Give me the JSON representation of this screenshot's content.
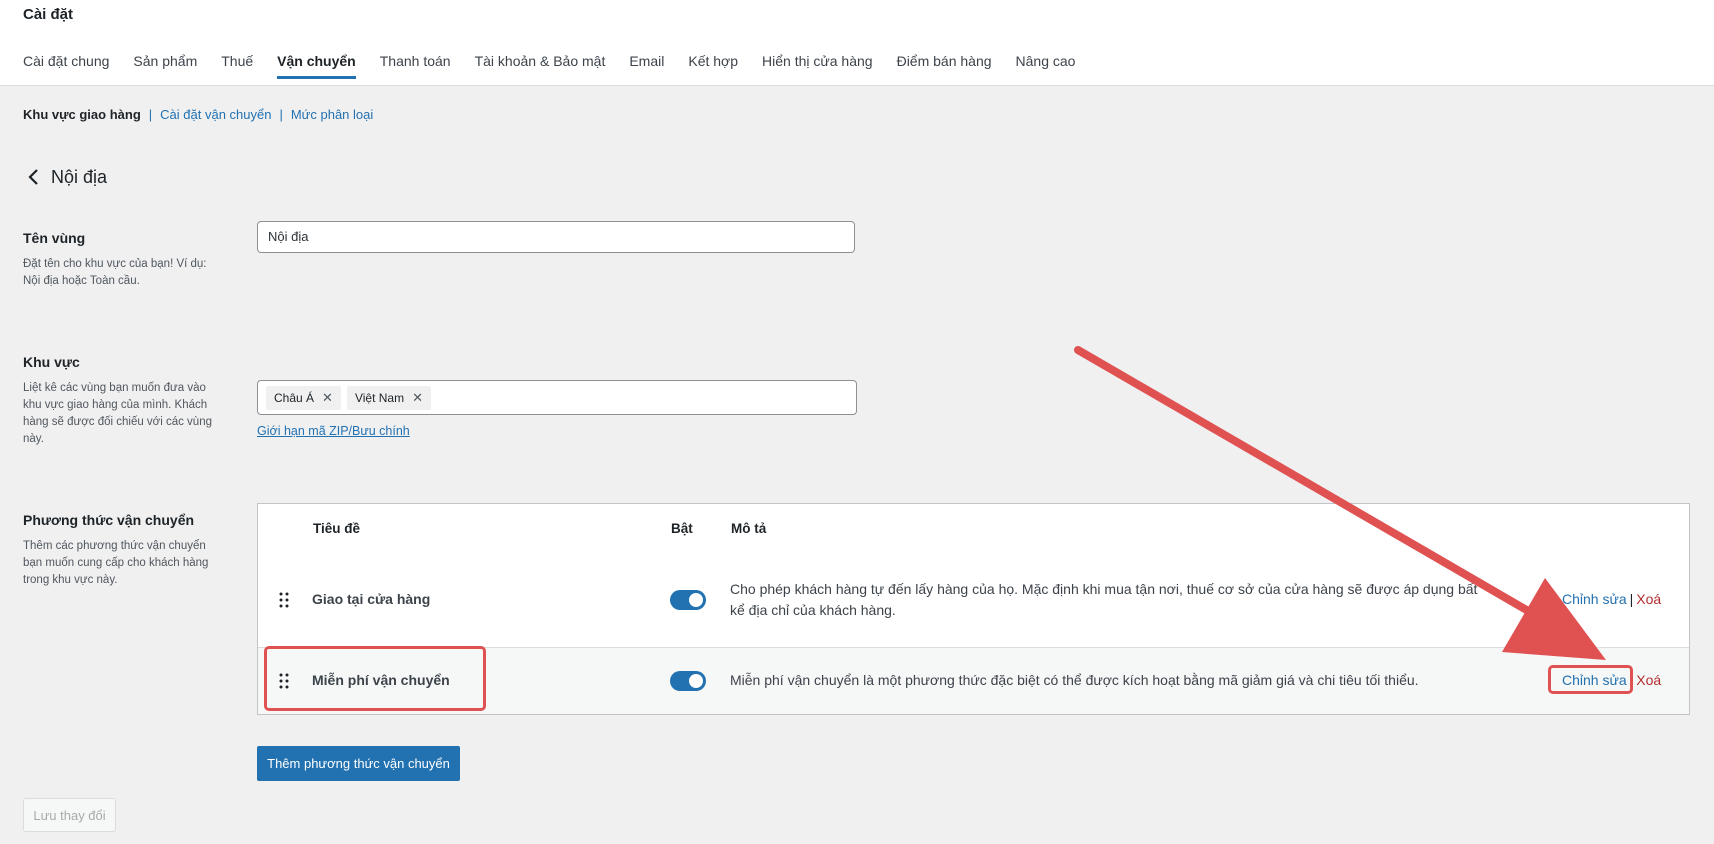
{
  "header": {
    "title": "Cài đặt",
    "tabs": [
      "Cài đặt chung",
      "Sản phẩm",
      "Thuế",
      "Vận chuyển",
      "Thanh toán",
      "Tài khoản & Bảo mật",
      "Email",
      "Kết hợp",
      "Hiển thị cửa hàng",
      "Điểm bán hàng",
      "Nâng cao"
    ],
    "active_tab": "Vận chuyển"
  },
  "subnav": {
    "current": "Khu vực giao hàng",
    "links": [
      "Cài đặt vận chuyển",
      "Mức phân loại"
    ],
    "separator": "|"
  },
  "zone": {
    "back_title": "Nội địa",
    "name_label": "Tên vùng",
    "name_desc": "Đặt tên cho khu vực của bạn! Ví dụ: Nội địa hoặc Toàn cầu.",
    "name_value": "Nội địa",
    "region_label": "Khu vực",
    "region_desc": "Liệt kê các vùng bạn muốn đưa vào khu vực giao hàng của mình. Khách hàng sẽ được đối chiếu với các vùng này.",
    "regions": [
      "Châu Á",
      "Việt Nam"
    ],
    "chip_remove": "✕",
    "zip_link": "Giới hạn mã ZIP/Bưu chính",
    "methods_label": "Phương thức vận chuyển",
    "methods_desc": "Thêm các phương thức vận chuyển bạn muốn cung cấp cho khách hàng trong khu vực này."
  },
  "methods_table": {
    "columns": [
      "Tiêu đề",
      "Bật",
      "Mô tả"
    ],
    "rows": [
      {
        "title": "Giao tại cửa hàng",
        "enabled": true,
        "description": "Cho phép khách hàng tự đến lấy hàng của họ. Mặc định khi mua tận nơi, thuế cơ sở của cửa hàng sẽ được áp dụng bất kể địa chỉ của khách hàng.",
        "edit": "Chỉnh sửa",
        "delete": "Xoá"
      },
      {
        "title": "Miễn phí vận chuyển",
        "enabled": true,
        "description": "Miễn phí vận chuyển là một phương thức đặc biệt có thể được kích hoạt bằng mã giảm giá và chi tiêu tối thiểu.",
        "edit": "Chỉnh sửa",
        "delete": "Xoá"
      }
    ],
    "action_separator": "|"
  },
  "buttons": {
    "add_method": "Thêm phương thức vận chuyển",
    "save": "Lưu thay đổi"
  },
  "colors": {
    "accent": "#2271b1",
    "annotation": "#e05252",
    "delete": "#b32d2e"
  }
}
